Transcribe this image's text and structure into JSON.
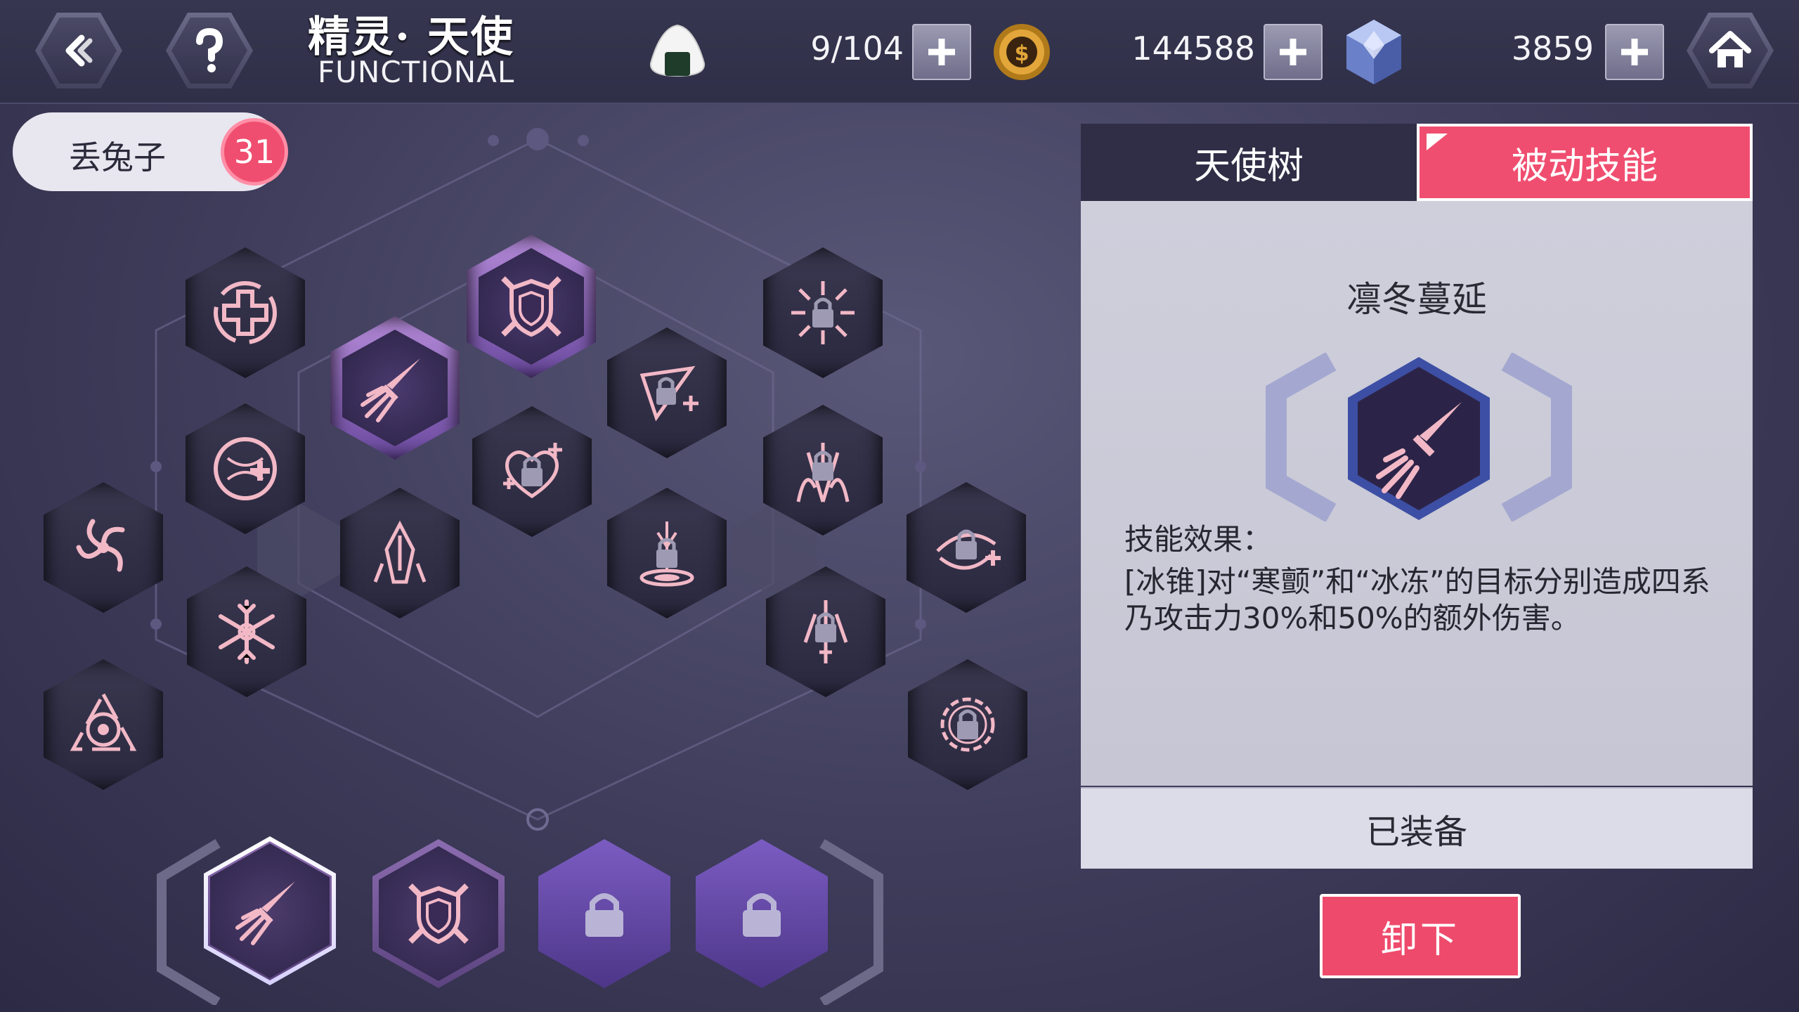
{
  "header": {
    "title_cn": "精灵· 天使",
    "title_en": "FUNCTIONAL",
    "stamina": "9/104",
    "gold": "144588",
    "gems": "3859"
  },
  "user": {
    "name": "丢兔子",
    "level": "31"
  },
  "tabs": {
    "tree": "天使树",
    "passive": "被动技能"
  },
  "skill_detail": {
    "name": "凛冬蔓延",
    "effect_title": "技能效果：",
    "effect_text": "[冰锥]对“寒颤”和“冰冻”的目标分别造成四系乃攻击力30%和50%的额外伤害。",
    "equipped_label": "已装备"
  },
  "actions": {
    "unequip": "卸下"
  },
  "colors": {
    "accent": "#f04e70",
    "panel_bg": "#cfcfdc",
    "bg_dark": "#2f2e46"
  }
}
